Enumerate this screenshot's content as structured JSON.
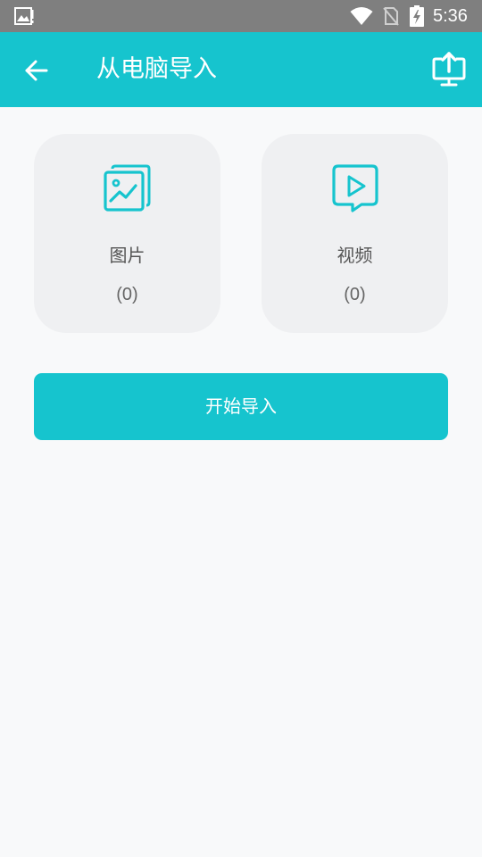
{
  "status_bar": {
    "time": "5:36",
    "icons": [
      "image-notification-icon",
      "wifi-icon",
      "no-sim-icon",
      "battery-charging-icon"
    ]
  },
  "app_bar": {
    "title": "从电脑导入",
    "back_icon": "arrow-left-icon",
    "action_icon": "upload-to-monitor-icon",
    "color": "#16c4ce"
  },
  "cards": [
    {
      "label": "图片",
      "count": "(0)",
      "icon": "image-gallery-icon"
    },
    {
      "label": "视频",
      "count": "(0)",
      "icon": "video-play-icon"
    }
  ],
  "start_button": {
    "label": "开始导入"
  },
  "colors": {
    "accent": "#16c4ce",
    "card_bg": "#eff0f2",
    "page_bg": "#f8f9fa",
    "status_bar": "#7f7f7f"
  }
}
